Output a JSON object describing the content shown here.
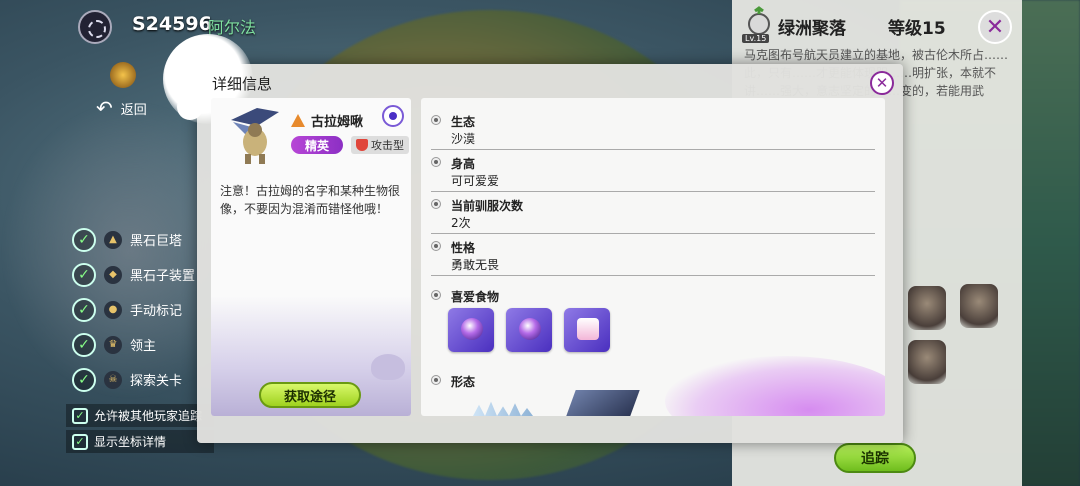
{
  "header": {
    "server_id": "S24596",
    "player_name": "阿尔法",
    "back_label": "返回"
  },
  "checklist": [
    {
      "label": "黑石巨塔",
      "checked": true
    },
    {
      "label": "黑石子装置",
      "checked": true
    },
    {
      "label": "手动标记",
      "checked": true
    },
    {
      "label": "领主",
      "checked": true
    },
    {
      "label": "探索关卡",
      "checked": true
    }
  ],
  "options": [
    {
      "label": "允许被其他玩家追踪",
      "checked": true
    },
    {
      "label": "显示坐标详情",
      "checked": true
    }
  ],
  "right_panel": {
    "title": "绿洲聚落",
    "level": "等级15",
    "avatar_level": "Lv.15",
    "description": "马克图布号航天员建立的基地，被古伦木所占……此，只有……才更能体现胆……明扩张，本就不讲……强大，意志坚定的……变的，若能用武力……从其中获得不少利",
    "track_label": "追踪"
  },
  "modal": {
    "title": "详细信息",
    "creature": {
      "name": "古拉姆啾",
      "rank": "精英",
      "type": "攻击型",
      "description": "注意！古拉姆的名字和某种生物很像，不要因为混淆而错怪他哦！",
      "acquire_label": "获取途径"
    },
    "info": {
      "habitat_label": "生态",
      "habitat_value": "沙漠",
      "height_label": "身高",
      "height_value": "可可爱爱",
      "tame_label": "当前驯服次数",
      "tame_value": "2次",
      "personality_label": "性格",
      "personality_value": "勇敢无畏",
      "food_label": "喜爱食物",
      "form_label": "形态"
    }
  },
  "colors": {
    "accent_purple": "#8a2a9a",
    "button_green": "#9fd21f",
    "elite_purple": "#b746d6"
  }
}
